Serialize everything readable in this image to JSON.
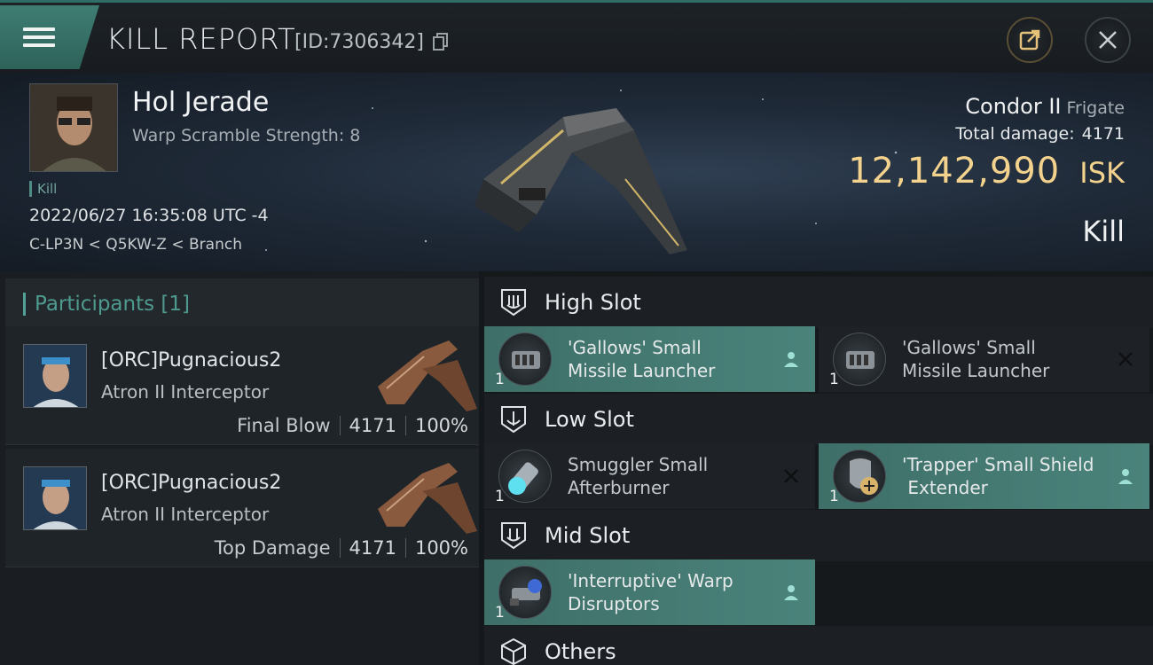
{
  "header": {
    "title": "KILL REPORT",
    "report_id": "[ID:7306342]"
  },
  "victim": {
    "name": "Hol Jerade",
    "subtitle": "Warp Scramble Strength: 8",
    "tag": "Kill",
    "datetime": "2022/06/27 16:35:08 UTC -4",
    "location": "C-LP3N < Q5KW-Z < Branch",
    "ship_name": "Condor II",
    "ship_class": "Frigate",
    "total_damage_label": "Total damage:",
    "total_damage": "4171",
    "isk_value": "12,142,990",
    "isk_unit": "ISK",
    "result": "Kill"
  },
  "participants": {
    "header": "Participants [1]",
    "items": [
      {
        "name": "[ORC]Pugnacious2",
        "ship": "Atron II Interceptor",
        "role": "Final Blow",
        "damage": "4171",
        "percent": "100%"
      },
      {
        "name": "[ORC]Pugnacious2",
        "ship": "Atron II Interceptor",
        "role": "Top Damage",
        "damage": "4171",
        "percent": "100%"
      }
    ]
  },
  "fitting": {
    "high_slot": "High Slot",
    "low_slot": "Low Slot",
    "mid_slot": "Mid Slot",
    "others": "Others",
    "high": [
      {
        "line1": "'Gallows' Small",
        "line2": "Missile Launcher",
        "qty": "1",
        "state": "fitted"
      },
      {
        "line1": "'Gallows' Small",
        "line2": "Missile Launcher",
        "qty": "1",
        "state": "dropped"
      }
    ],
    "low": [
      {
        "line1": "Smuggler Small",
        "line2": "Afterburner",
        "qty": "1",
        "state": "dropped"
      },
      {
        "line1": "'Trapper' Small Shield",
        "line2": " Extender",
        "qty": "1",
        "state": "fitted"
      }
    ],
    "mid": [
      {
        "line1": "'Interruptive' Warp",
        "line2": "Disruptors",
        "qty": "1",
        "state": "fitted"
      }
    ]
  },
  "colors": {
    "accent": "#4a837b",
    "isk": "#f2d28c"
  }
}
